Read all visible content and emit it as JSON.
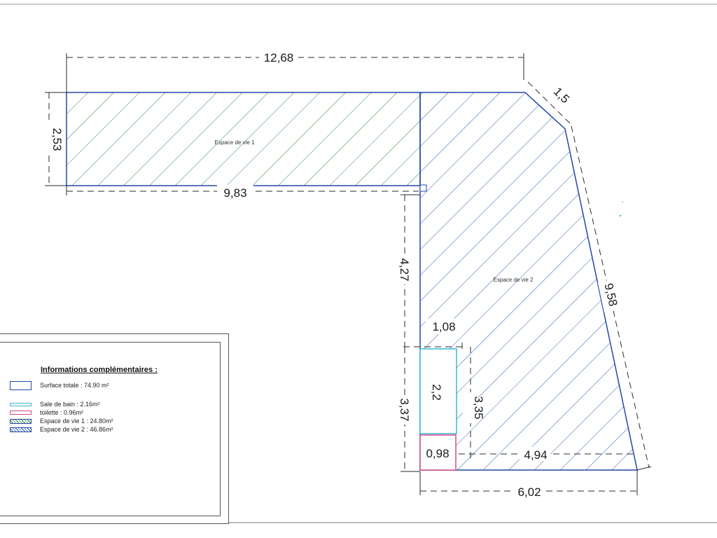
{
  "plan": {
    "rooms": [
      {
        "id": "espace-de-vie-1",
        "label": "Espace de vie 1",
        "hatch_color": "#2e8b3a"
      },
      {
        "id": "espace-de-vie-2",
        "label": "Espace de vie 2",
        "hatch_color": "#2a5fa8"
      },
      {
        "id": "salle-de-bain",
        "label": "",
        "outline_color": "#35b7d6"
      },
      {
        "id": "toilette",
        "label": "",
        "outline_color": "#d04a88"
      }
    ],
    "dimensions": {
      "top_width": "12,68",
      "corner_diagonal": "1,5",
      "left_height": "2,53",
      "inner_width": "9,83",
      "inner_height": "4,27",
      "right_slope": "9,58",
      "bath_width": "1,08",
      "bath_length": "2,2",
      "left_lower_height": "3,37",
      "bath_inner_height": "3,35",
      "toilet_width": "0,98",
      "bottom_right_width": "4,94",
      "bottom_width": "6,02"
    },
    "colors": {
      "outline": "#2347a8",
      "dimension_line": "#2b2b2b"
    }
  },
  "legend": {
    "title": "Informations complémentaires :",
    "items": [
      {
        "name": "legend-surface-totale",
        "text": "Surface totale : 74.90 m²",
        "swatch": "outline",
        "color": "#2347a8"
      },
      {
        "name": "legend-salle-de-bain",
        "text": "Sale de bain : 2.16m²",
        "swatch": "line",
        "color": "#35b7d6"
      },
      {
        "name": "legend-toilette",
        "text": "toilette : 0.96m²",
        "swatch": "line",
        "color": "#d04a88"
      },
      {
        "name": "legend-espace-vie-1",
        "text": "Espace de vie 1 : 24.80m²",
        "swatch": "hatch",
        "color": "#2e8b3a"
      },
      {
        "name": "legend-espace-vie-2",
        "text": "Espace de vie 2 : 46.86m²",
        "swatch": "hatch",
        "color": "#2a5fa8"
      }
    ]
  }
}
